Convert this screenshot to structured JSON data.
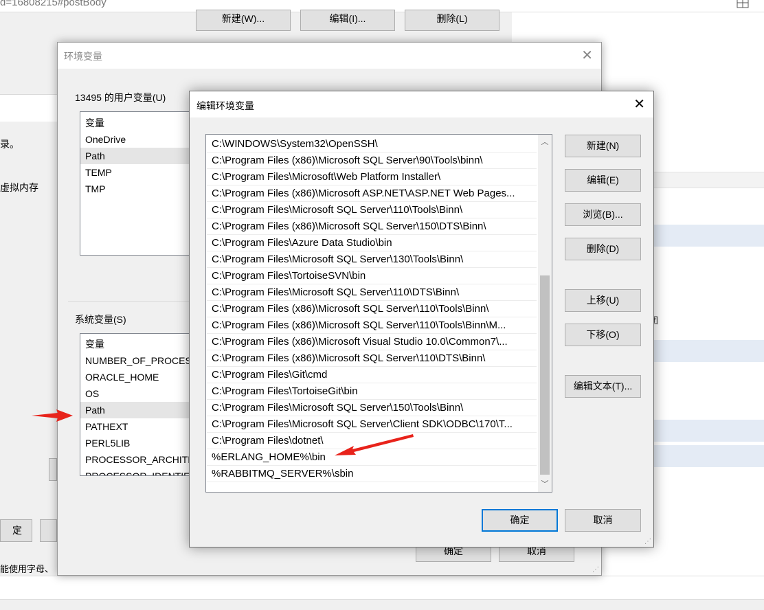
{
  "browser": {
    "url_fragment": "d=16808215#postBody"
  },
  "background_page": {
    "top_buttons": [
      "新建(W)...",
      "编辑(I)...",
      "删除(L)"
    ],
    "left_texts": [
      "录。",
      "虚拟内存"
    ],
    "left_button_ok": "定",
    "bottom_hint": "能使用字母、",
    "right_side_char": "团"
  },
  "env_dialog": {
    "title": "环境变量",
    "user_section_label": "13495 的用户变量(U)",
    "user_list_header": "变量",
    "user_vars": [
      "OneDrive",
      "Path",
      "TEMP",
      "TMP"
    ],
    "user_selected": "Path",
    "system_section_label": "系统变量(S)",
    "system_list_header": "变量",
    "system_vars": [
      "NUMBER_OF_PROCESSORS",
      "ORACLE_HOME",
      "OS",
      "Path",
      "PATHEXT",
      "PERL5LIB",
      "PROCESSOR_ARCHITECTURE",
      "PROCESSOR_IDENTIFIER"
    ],
    "system_selected": "Path",
    "ok_label": "确定",
    "cancel_label": "取消"
  },
  "edit_dialog": {
    "title": "编辑环境变量",
    "paths": [
      "C:\\WINDOWS\\System32\\OpenSSH\\",
      "C:\\Program Files (x86)\\Microsoft SQL Server\\90\\Tools\\binn\\",
      "C:\\Program Files\\Microsoft\\Web Platform Installer\\",
      "C:\\Program Files (x86)\\Microsoft ASP.NET\\ASP.NET Web Pages...",
      "C:\\Program Files\\Microsoft SQL Server\\110\\Tools\\Binn\\",
      "C:\\Program Files (x86)\\Microsoft SQL Server\\150\\DTS\\Binn\\",
      "C:\\Program Files\\Azure Data Studio\\bin",
      "C:\\Program Files\\Microsoft SQL Server\\130\\Tools\\Binn\\",
      "C:\\Program Files\\TortoiseSVN\\bin",
      "C:\\Program Files\\Microsoft SQL Server\\110\\DTS\\Binn\\",
      "C:\\Program Files (x86)\\Microsoft SQL Server\\110\\Tools\\Binn\\",
      "C:\\Program Files (x86)\\Microsoft SQL Server\\110\\Tools\\Binn\\M...",
      "C:\\Program Files (x86)\\Microsoft Visual Studio 10.0\\Common7\\...",
      "C:\\Program Files (x86)\\Microsoft SQL Server\\110\\DTS\\Binn\\",
      "C:\\Program Files\\Git\\cmd",
      "C:\\Program Files\\TortoiseGit\\bin",
      "C:\\Program Files\\Microsoft SQL Server\\150\\Tools\\Binn\\",
      "C:\\Program Files\\Microsoft SQL Server\\Client SDK\\ODBC\\170\\T...",
      "C:\\Program Files\\dotnet\\",
      "%ERLANG_HOME%\\bin",
      "%RABBITMQ_SERVER%\\sbin"
    ],
    "buttons": {
      "new": "新建(N)",
      "edit": "编辑(E)",
      "browse": "浏览(B)...",
      "delete": "删除(D)",
      "move_up": "上移(U)",
      "move_down": "下移(O)",
      "edit_text": "编辑文本(T)..."
    },
    "ok_label": "确定",
    "cancel_label": "取消"
  },
  "annotation_color": "#e8231b"
}
